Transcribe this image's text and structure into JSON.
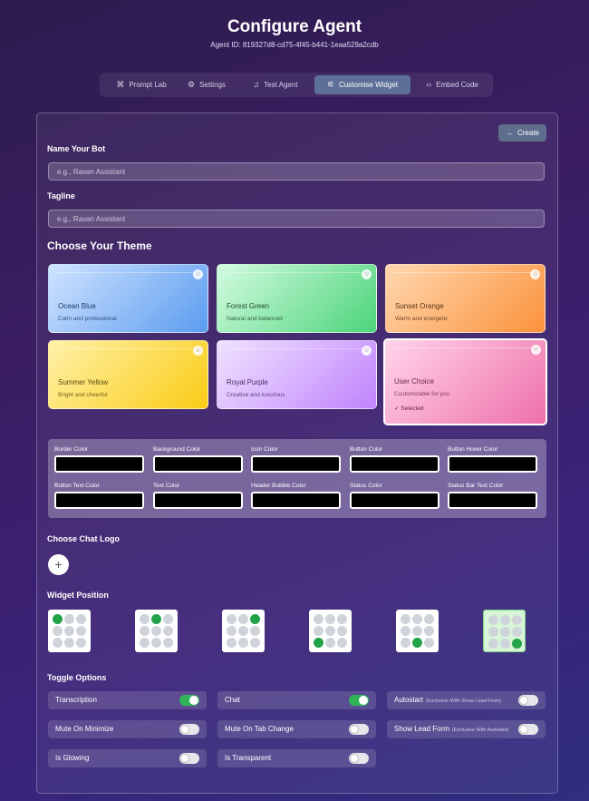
{
  "header": {
    "title": "Configure Agent",
    "agent_id": "Agent ID: 819327d8-cd75-4f45-b441-1eaa529a2cdb"
  },
  "tabs": [
    {
      "label": "Prompt Lab",
      "icon": "command-icon",
      "glyph": "⌘"
    },
    {
      "label": "Settings",
      "icon": "gear-icon",
      "glyph": "⚙"
    },
    {
      "label": "Test Agent",
      "icon": "headset-icon",
      "glyph": "♫"
    },
    {
      "label": "Customise Widget",
      "icon": "sliders-icon",
      "glyph": "⚟"
    },
    {
      "label": "Embed Code",
      "icon": "code-icon",
      "glyph": "‹›"
    }
  ],
  "active_tab": "Customise Widget",
  "form": {
    "create_label": "Create",
    "create_icon": "→",
    "name_label": "Name Your Bot",
    "name_placeholder": "e.g., Ravan Assistant",
    "tagline_label": "Tagline",
    "tagline_placeholder": "e.g., Ravan Assistant"
  },
  "themes": {
    "heading": "Choose Your Theme",
    "selected_label": "✓ Selected",
    "items": [
      {
        "name": "Ocean Blue",
        "desc": "Calm and professional"
      },
      {
        "name": "Forest Green",
        "desc": "Natural and balanced"
      },
      {
        "name": "Sunset Orange",
        "desc": "Warm and energetic"
      },
      {
        "name": "Summer Yellow",
        "desc": "Bright and cheerful"
      },
      {
        "name": "Royal Purple",
        "desc": "Creative and luxurious"
      },
      {
        "name": "User Choice",
        "desc": "Customizable for you"
      }
    ],
    "selected": "User Choice"
  },
  "colors": {
    "fields": [
      {
        "label": "Border Color",
        "value": "#000000"
      },
      {
        "label": "Background Color",
        "value": "#000000"
      },
      {
        "label": "Icon Color",
        "value": "#000000"
      },
      {
        "label": "Button Color",
        "value": "#000000"
      },
      {
        "label": "Button Hover Color",
        "value": "#000000"
      },
      {
        "label": "Button Text Color",
        "value": "#000000"
      },
      {
        "label": "Text Color",
        "value": "#000000"
      },
      {
        "label": "Header Bubble Color",
        "value": "#000000"
      },
      {
        "label": "Status Color",
        "value": "#000000"
      },
      {
        "label": "Status Bar Text Color",
        "value": "#000000"
      }
    ]
  },
  "logo": {
    "heading": "Choose Chat Logo",
    "add_glyph": "+"
  },
  "position": {
    "heading": "Widget Position",
    "options": [
      {
        "name": "top-left",
        "dot": [
          0,
          0
        ]
      },
      {
        "name": "top-center",
        "dot": [
          0,
          1
        ]
      },
      {
        "name": "top-right",
        "dot": [
          0,
          2
        ]
      },
      {
        "name": "bottom-left",
        "dot": [
          2,
          0
        ]
      },
      {
        "name": "bottom-center",
        "dot": [
          2,
          1
        ]
      },
      {
        "name": "bottom-right",
        "dot": [
          2,
          2
        ]
      }
    ],
    "selected": "bottom-right"
  },
  "toggles": {
    "heading": "Toggle Options",
    "items": [
      {
        "label": "Transcription",
        "on": true,
        "note": ""
      },
      {
        "label": "Chat",
        "on": true,
        "note": ""
      },
      {
        "label": "Autostart",
        "on": false,
        "note": "(Exclusive With Show Lead Form)"
      },
      {
        "label": "Mute On Minimize",
        "on": false,
        "note": ""
      },
      {
        "label": "Mute On Tab Change",
        "on": false,
        "note": ""
      },
      {
        "label": "Show Lead Form",
        "on": false,
        "note": "(Exclusive With Autostart)"
      },
      {
        "label": "Is Glowing",
        "on": false,
        "note": ""
      },
      {
        "label": "Is Transparent",
        "on": false,
        "note": ""
      }
    ]
  },
  "palette": {
    "accent": "#5e6f97",
    "toggle_on": "#2fb45a",
    "position_dot_on": "#22a34a",
    "ocean_blue": [
      "#cfe3ff",
      "#5b9cf0"
    ],
    "forest_green": [
      "#d3fbe0",
      "#4cd47a"
    ],
    "sunset_orange": [
      "#ffd8b0",
      "#fb923c"
    ],
    "summer_yellow": [
      "#fff1a8",
      "#facc15"
    ],
    "royal_purple": [
      "#efe2ff",
      "#c084fc"
    ],
    "user_choice": [
      "#ffd4ea",
      "#ee70aa"
    ]
  }
}
